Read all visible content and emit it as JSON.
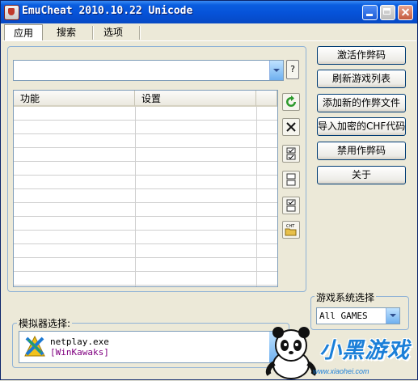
{
  "window": {
    "title": "EmuCheat 2010.10.22 Unicode"
  },
  "tabs": [
    {
      "label": "应用"
    },
    {
      "label": "搜索"
    },
    {
      "label": "选项"
    }
  ],
  "main": {
    "combo_value": "",
    "help_label": "?",
    "table": {
      "columns": [
        "功能",
        "设置"
      ],
      "rows": []
    }
  },
  "side_tools": [
    {
      "icon": "refresh-icon"
    },
    {
      "icon": "delete-icon"
    },
    {
      "icon": "check-all-icon"
    },
    {
      "icon": "uncheck-all-icon"
    },
    {
      "icon": "invert-check-icon"
    },
    {
      "icon": "open-cht-folder-icon"
    }
  ],
  "side_tools_cht_text": "CHT",
  "buttons": [
    {
      "label": "激活作弊码"
    },
    {
      "label": "刷新游戏列表"
    },
    {
      "label": "添加新的作弊文件"
    },
    {
      "label": "导入加密的CHF代码"
    },
    {
      "label": "禁用作弊码"
    },
    {
      "label": "关于"
    }
  ],
  "game_system": {
    "label": "游戏系统选择",
    "value": "All GAMES"
  },
  "emulator": {
    "label": "模拟器选择:",
    "exe": "netplay.exe",
    "name": "[WinKawaks]"
  },
  "watermark": {
    "text": "小黑游戏",
    "url": "www.xiaohei.com"
  }
}
